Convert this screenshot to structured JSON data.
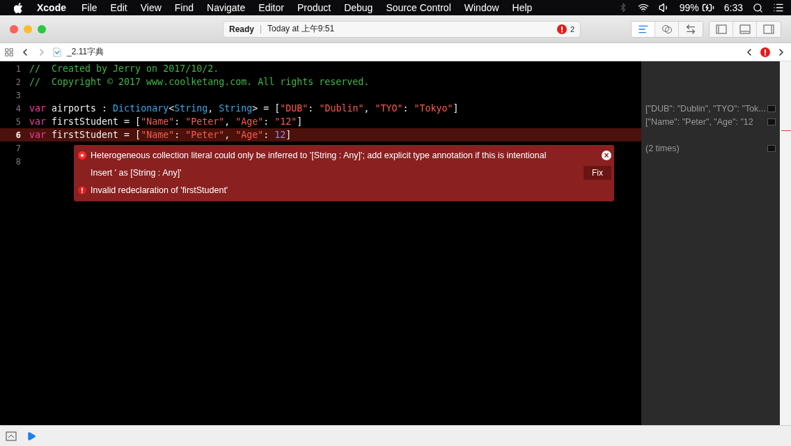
{
  "menu_bar": {
    "app": "Xcode",
    "items": [
      "File",
      "Edit",
      "View",
      "Find",
      "Navigate",
      "Editor",
      "Product",
      "Debug",
      "Source Control",
      "Window",
      "Help"
    ],
    "battery": "99%",
    "time": "6:33"
  },
  "toolbar": {
    "status": "Ready",
    "timestamp": "Today at 上午9:51",
    "issue_count": "2",
    "editor_modes": [
      {
        "kind": "standard",
        "selected": true
      },
      {
        "kind": "assistant",
        "selected": false
      },
      {
        "kind": "version",
        "selected": false
      }
    ],
    "panels": [
      {
        "kind": "left"
      },
      {
        "kind": "bottom"
      },
      {
        "kind": "right"
      }
    ]
  },
  "jump_bar": {
    "file": "_2.11字典"
  },
  "lines": [
    {
      "number": "1",
      "highlighted": false,
      "tokens": [
        {
          "kind": "comment",
          "text": "//  Created by Jerry on 2017/10/2."
        }
      ]
    },
    {
      "number": "2",
      "highlighted": false,
      "tokens": [
        {
          "kind": "comment",
          "text": "//  Copyright © 2017 www.coolketang.com. All rights reserved."
        }
      ]
    },
    {
      "number": "3",
      "highlighted": false
    },
    {
      "number": "4",
      "highlighted": false,
      "result": "[\"DUB\": \"Dublin\", \"TYO\": \"Tok...",
      "tokens": [
        {
          "kind": "keyword",
          "text": "var"
        },
        {
          "kind": "plain",
          "text": " airports : "
        },
        {
          "kind": "type",
          "text": "Dictionary"
        },
        {
          "kind": "plain",
          "text": "<"
        },
        {
          "kind": "type",
          "text": "String"
        },
        {
          "kind": "plain",
          "text": ", "
        },
        {
          "kind": "type",
          "text": "String"
        },
        {
          "kind": "plain",
          "text": "> = ["
        },
        {
          "kind": "string",
          "text": "\"DUB\""
        },
        {
          "kind": "plain",
          "text": ": "
        },
        {
          "kind": "string",
          "text": "\"Dublin\""
        },
        {
          "kind": "plain",
          "text": ", "
        },
        {
          "kind": "string",
          "text": "\"TYO\""
        },
        {
          "kind": "plain",
          "text": ": "
        },
        {
          "kind": "string",
          "text": "\"Tokyo\""
        },
        {
          "kind": "plain",
          "text": "]"
        }
      ]
    },
    {
      "number": "5",
      "highlighted": false,
      "result": "[\"Name\": \"Peter\", \"Age\": \"12",
      "tokens": [
        {
          "kind": "keyword",
          "text": "var"
        },
        {
          "kind": "plain",
          "text": " firstStudent = ["
        },
        {
          "kind": "string",
          "text": "\"Name\""
        },
        {
          "kind": "plain",
          "text": ": "
        },
        {
          "kind": "string",
          "text": "\"Peter\""
        },
        {
          "kind": "plain",
          "text": ", "
        },
        {
          "kind": "string",
          "text": "\"Age\""
        },
        {
          "kind": "plain",
          "text": ": "
        },
        {
          "kind": "string",
          "text": "\"12\""
        },
        {
          "kind": "plain",
          "text": "]"
        }
      ]
    },
    {
      "number": "6",
      "highlighted": true,
      "tokens": [
        {
          "kind": "keyword",
          "text": "var"
        },
        {
          "kind": "plain",
          "text": " firstStudent = ["
        },
        {
          "kind": "string",
          "text": "\"Name\""
        },
        {
          "kind": "plain",
          "text": ": "
        },
        {
          "kind": "string",
          "text": "\"Peter\""
        },
        {
          "kind": "plain",
          "text": ", "
        },
        {
          "kind": "string",
          "text": "\"Age\""
        },
        {
          "kind": "plain",
          "text": ": "
        },
        {
          "kind": "number",
          "text": "12"
        },
        {
          "kind": "plain",
          "text": "]"
        }
      ]
    },
    {
      "number": "7",
      "highlighted": false,
      "result": "(2 times)"
    },
    {
      "number": "8",
      "highlighted": false
    }
  ],
  "issues": [
    {
      "kind": "error",
      "message": "Heterogeneous collection literal could only be inferred to '[String : Any]'; add explicit type annotation if this is intentional",
      "close": "×"
    },
    {
      "kind": "fixit",
      "message": "Insert ' as [String : Any]'",
      "action": "Fix"
    },
    {
      "kind": "error_mark",
      "message": "Invalid redeclaration of 'firstStudent'"
    }
  ]
}
